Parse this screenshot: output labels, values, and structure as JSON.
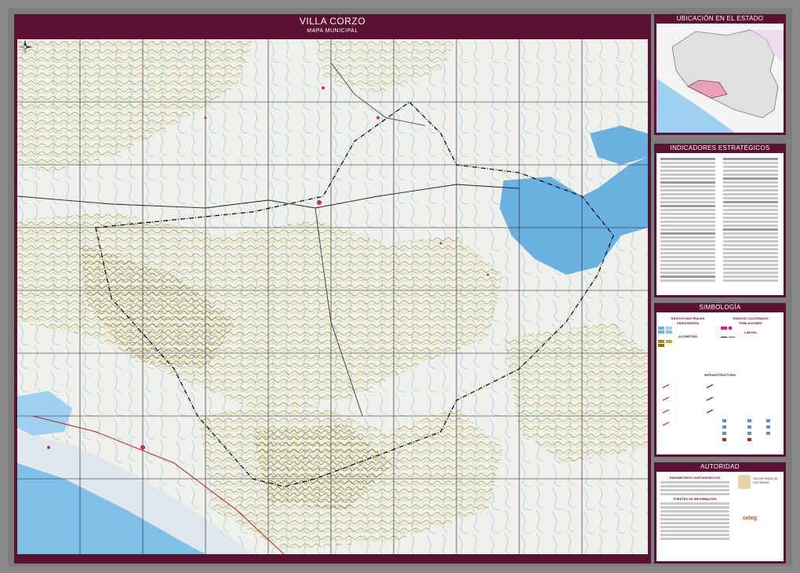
{
  "map": {
    "title": "VILLA CORZO",
    "subtitle": "MAPA MUNICIPAL"
  },
  "panels": {
    "location": "UBICACIÓN EN EL ESTADO",
    "indicators": "INDICADORES ESTRATÉGICOS",
    "legend": "SIMBOLOGÍA",
    "authority": "AUTORIDAD"
  },
  "legend": {
    "natural": "RASGOS NATURALES",
    "cultural": "RASGOS CULTURALES",
    "hydrography": "HIDROGRAFÍA",
    "settlements": "POBLACIONES",
    "altimetry": "ALTIMETRÍA",
    "limits": "LÍMITES",
    "infrastructure": "INFRAESTRUCTURA"
  },
  "authority": {
    "cartographic": "PARÁMETROS CARTOGRÁFICOS",
    "sources": "FUENTES DE INFORMACIÓN",
    "agency": "SECRETARÍA DE HACIENDA",
    "brand": "celeg"
  },
  "colors": {
    "frame": "#5b1232",
    "contour": "#a08a1a",
    "water": "#6ab0e0",
    "sea": "#7ec0e8",
    "boundary": "#111111"
  },
  "icons": {
    "north_arrow": "compass-rose-icon"
  }
}
